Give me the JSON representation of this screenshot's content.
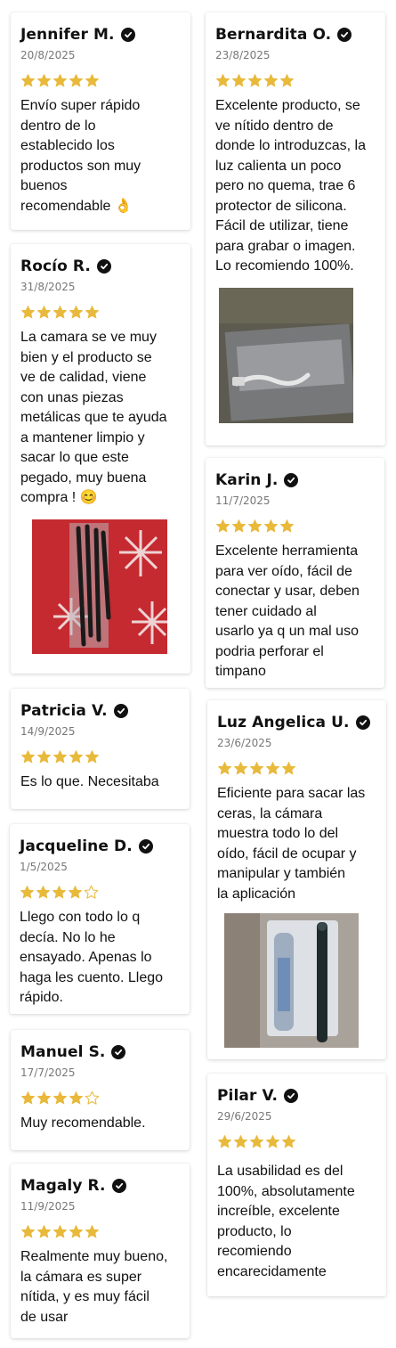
{
  "reviews": [
    {
      "name": "Jennifer M.",
      "date": "20/8/2025",
      "rating": 5,
      "text": "Envío super rápido\ndentro de lo\nestablecido los\nproductos son muy\nbuenos\nrecomendable 👌"
    },
    {
      "name": "Rocío R.",
      "date": "31/8/2025",
      "rating": 5,
      "text": "La camara se ve muy\nbien y el producto se\nve de calidad, viene\ncon unas piezas\nmetálicas que te ayuda\na mantener limpio y\nsacar lo que este\npegado, muy buena\ncompra ! 😊"
    },
    {
      "name": "Patricia V.",
      "date": "14/9/2025",
      "rating": 5,
      "text": "Es lo que. Necesitaba"
    },
    {
      "name": "Jacqueline D.",
      "date": "1/5/2025",
      "rating": 4,
      "text": "Llego con todo lo q\ndecía. No lo he\nensayado. Apenas lo\nhaga les cuento. Llego\nrápido."
    },
    {
      "name": "Manuel S.",
      "date": "17/7/2025",
      "rating": 4,
      "text": "Muy recomendable."
    },
    {
      "name": "Magaly R.",
      "date": "11/9/2025",
      "rating": 5,
      "text": "Realmente muy bueno,\nla cámara es super\nnítida, y es muy fácil\nde usar"
    },
    {
      "name": "Bernardita O.",
      "date": "23/8/2025",
      "rating": 5,
      "text": "Excelente producto, se\nve nítido dentro de\ndonde lo introduzcas, la\nluz calienta un poco\npero no quema, trae 6\nprotector de silicona.\nFácil de utilizar, tiene\npara grabar o imagen.\nLo recomiendo 100%."
    },
    {
      "name": "Karin J.",
      "date": "11/7/2025",
      "rating": 5,
      "text": "Excelente herramienta\npara ver oído, fácil de\nconectar y usar, deben\ntener cuidado al\nusarlo ya q un mal uso\npodria perforar el\ntimpano"
    },
    {
      "name": "Luz Angelica U.",
      "date": "23/6/2025",
      "rating": 5,
      "text": "Eficiente para sacar las\nceras, la cámara\nmuestra todo lo del\noído, fácil de ocupar y\nmanipular y también\nla aplicación"
    },
    {
      "name": "Pilar V.",
      "date": "29/6/2025",
      "rating": 5,
      "text": "La usabilidad es del\n100%, absolutamente\nincreíble, excelente\nproducto, lo\nrecomiendo\nencarecidamente"
    }
  ],
  "colors": {
    "star_filled": "#E8B93A",
    "star_empty_outline": "#E8B93A",
    "verified_badge": "#111111"
  }
}
